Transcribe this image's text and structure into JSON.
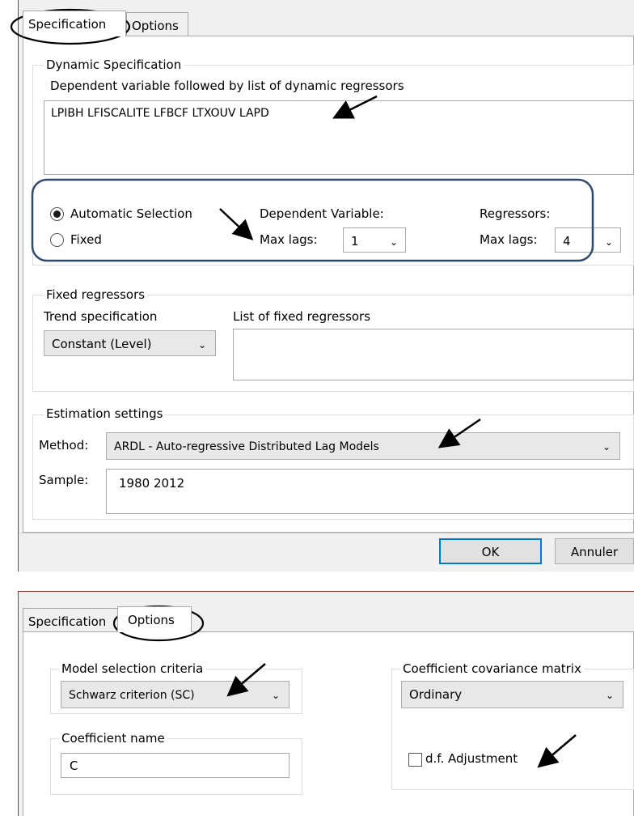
{
  "top_dialog": {
    "tabs": [
      "Specification",
      "Options"
    ],
    "dynamic": {
      "group_title": "Dynamic Specification",
      "caption": "Dependent variable followed by list of dynamic regressors",
      "text_value": "LPIBH LFISCALITE LFBCF LTXOUV LAPD",
      "auto_selection_label": "Automatic Selection",
      "fixed_label": "Fixed",
      "selected_mode": "Automatic Selection",
      "dependent_variable_label": "Dependent Variable:",
      "dep_max_lags_label": "Max lags:",
      "dep_max_lags_value": "1",
      "regressors_label": "Regressors:",
      "reg_max_lags_label": "Max lags:",
      "reg_max_lags_value": "4"
    },
    "fixed": {
      "group_title": "Fixed regressors",
      "trend_label": "Trend specification",
      "trend_value": "Constant (Level)",
      "list_label": "List of fixed regressors",
      "list_value": ""
    },
    "estimation": {
      "group_title": "Estimation settings",
      "method_label": "Method:",
      "method_value": "ARDL - Auto-regressive Distributed Lag Models",
      "sample_label": "Sample:",
      "sample_value": "1980 2012"
    },
    "buttons": {
      "ok": "OK",
      "cancel": "Annuler"
    }
  },
  "bottom_dialog": {
    "tabs": [
      "Specification",
      "Options"
    ],
    "model_selection": {
      "group_title": "Model selection criteria",
      "value": "Schwarz criterion (SC)"
    },
    "coef_name": {
      "group_title": "Coefficient name",
      "value": "C"
    },
    "covariance": {
      "group_title": "Coefficient covariance matrix",
      "value": "Ordinary",
      "df_adjust_label": "d.f. Adjustment",
      "df_adjust_checked": false
    }
  },
  "colors": {
    "dialog_bg": "#f0f0f0",
    "highlight_box": "#2e4a6e",
    "ok_button_border": "#0078d7",
    "annotation": "#000000"
  },
  "icons": [
    "chevron-down-icon",
    "radio-button",
    "checkbox",
    "annotation-arrow-icon",
    "annotation-circle",
    "annotation-rounded-box"
  ]
}
